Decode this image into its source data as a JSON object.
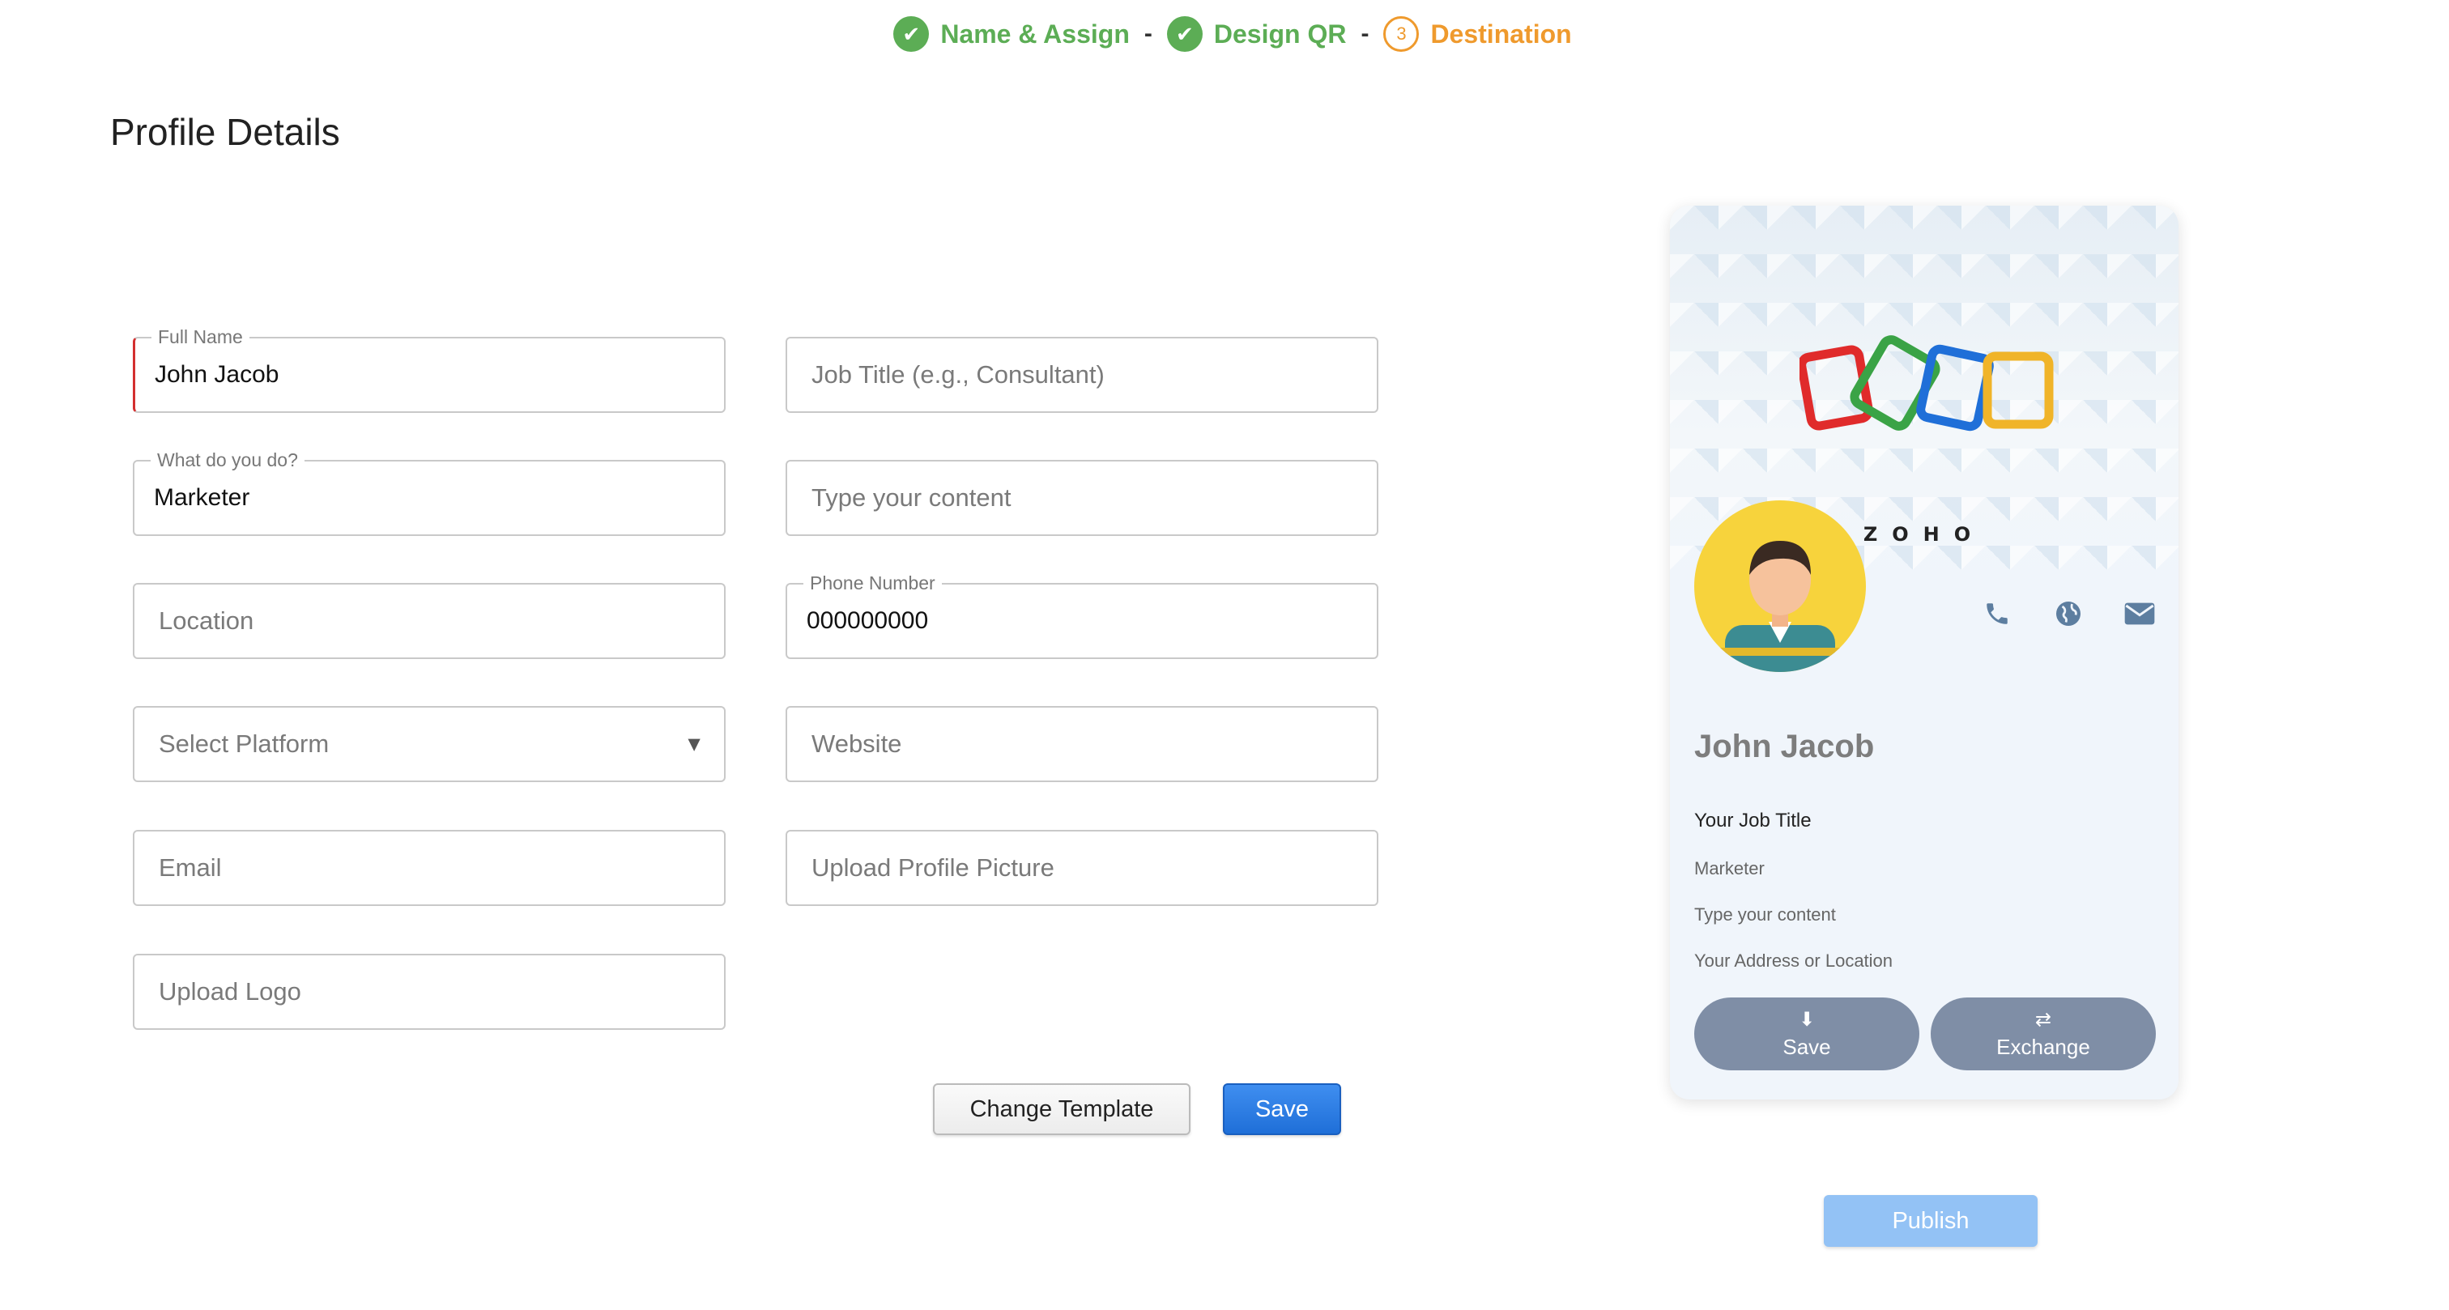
{
  "stepper": {
    "steps": [
      {
        "label": "Name & Assign",
        "state": "done"
      },
      {
        "label": "Design QR",
        "state": "done"
      },
      {
        "label": "Destination",
        "state": "current",
        "number": "3"
      }
    ],
    "separator": "-"
  },
  "page_title": "Profile Details",
  "form": {
    "full_name": {
      "label": "Full Name",
      "value": "John Jacob"
    },
    "job_title": {
      "placeholder": "Job Title (e.g., Consultant)"
    },
    "what_do_you_do": {
      "label": "What do you do?",
      "value": "Marketer"
    },
    "content": {
      "placeholder": "Type your content"
    },
    "location": {
      "placeholder": "Location"
    },
    "phone": {
      "label": "Phone Number",
      "value": "000000000"
    },
    "platform": {
      "placeholder": "Select Platform"
    },
    "website": {
      "placeholder": "Website"
    },
    "email": {
      "placeholder": "Email"
    },
    "profile_picture": {
      "placeholder": "Upload Profile Picture"
    },
    "logo": {
      "placeholder": "Upload Logo"
    }
  },
  "buttons": {
    "change_template": "Change Template",
    "save": "Save",
    "publish": "Publish"
  },
  "preview": {
    "logo_text": "ZOHO",
    "name": "John Jacob",
    "job_title": "Your Job Title",
    "role": "Marketer",
    "content": "Type your content",
    "location": "Your Address or Location",
    "save_label": "Save",
    "exchange_label": "Exchange",
    "icons": [
      "phone-icon",
      "globe-icon",
      "mail-icon"
    ]
  },
  "colors": {
    "done": "#5cad55",
    "current": "#ef9a2d",
    "primary": "#1f6fd8",
    "publish": "#93c2f5",
    "card_button": "#7f8ea6",
    "avatar_bg": "#f7d33c"
  }
}
